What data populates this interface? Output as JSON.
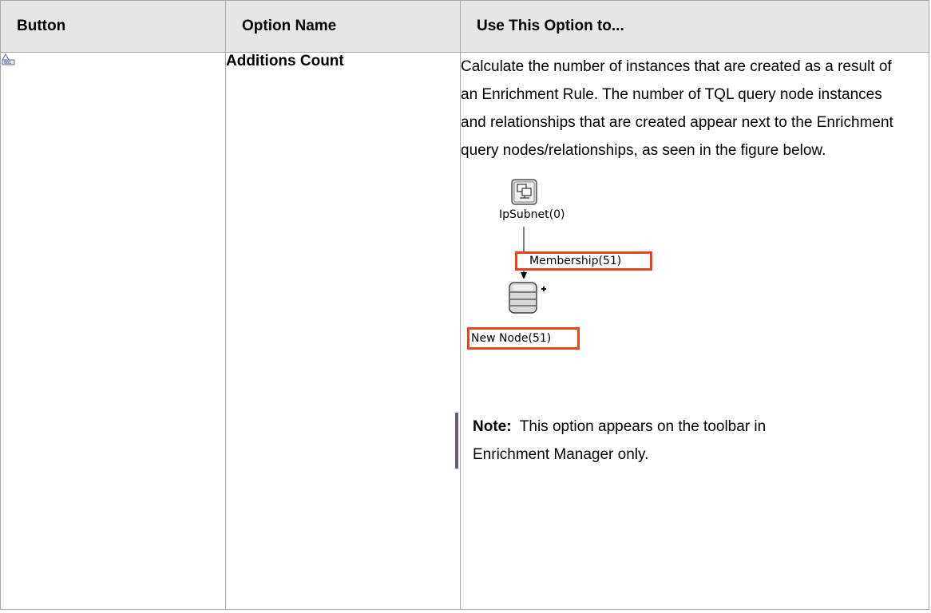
{
  "table": {
    "headers": [
      "Button",
      "Option Name",
      "Use This Option to..."
    ]
  },
  "row": {
    "button_icon": "additions-count-icon",
    "option_name": "Additions Count",
    "description": "Calculate the number of instances that are created as a result of an Enrichment Rule. The number of TQL query node instances and relationships that are created appear next to the Enrichment query nodes/relationships, as seen in the figure below.",
    "figure": {
      "top_node_label": "IpSubnet(0)",
      "relationship_label": "Membership(51)",
      "bottom_node_label": "New Node(51)",
      "highlight_color": "#e9441b"
    },
    "note_label": "Note:",
    "note_text": "This option appears on the toolbar in Enrichment Manager only."
  }
}
